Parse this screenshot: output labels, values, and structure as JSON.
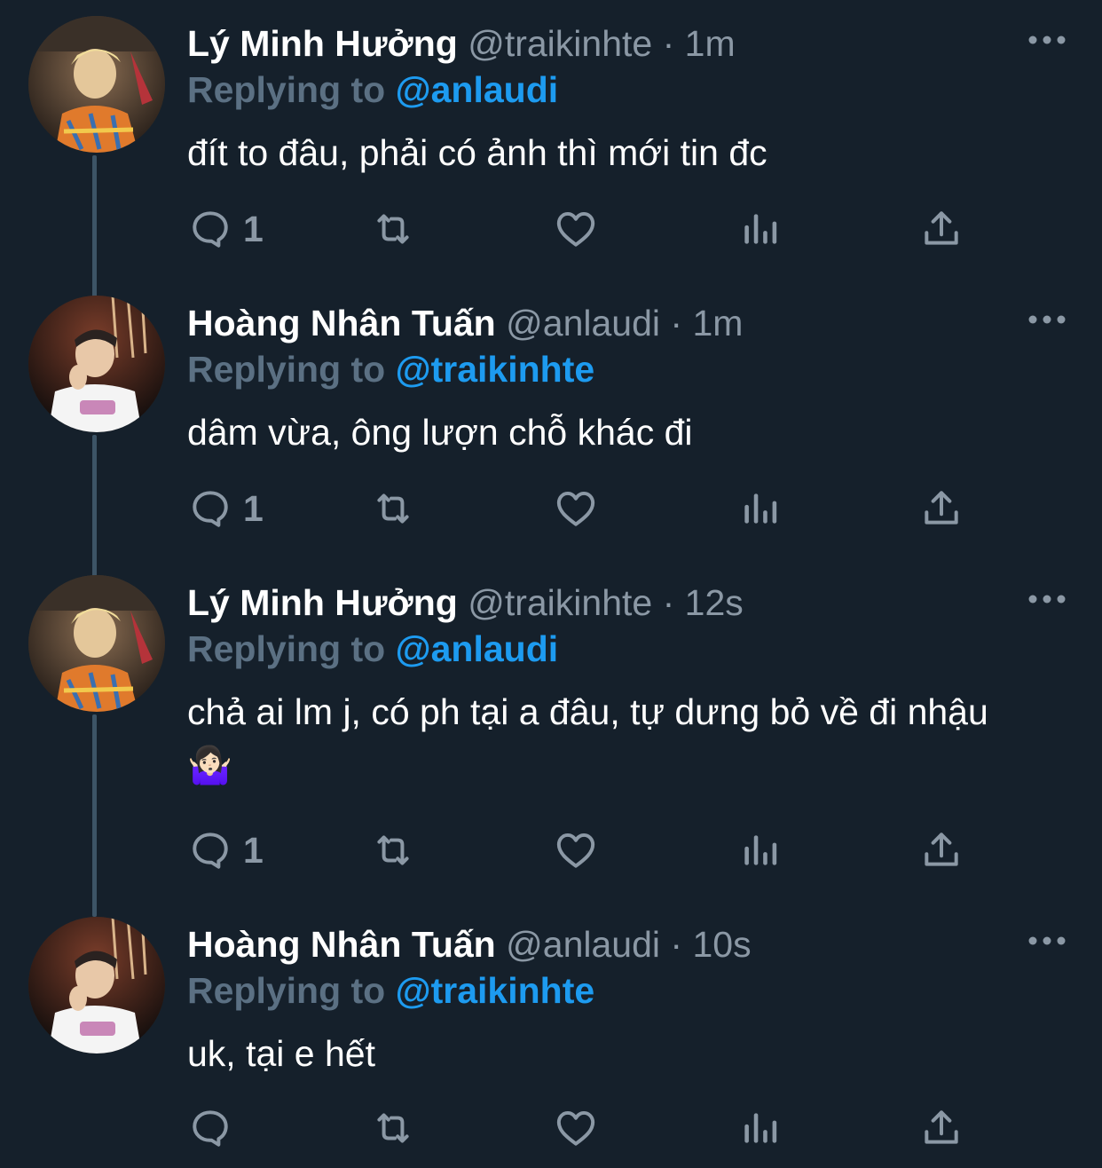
{
  "thread": {
    "tweets": [
      {
        "author_name": "Lý Minh Hưởng",
        "author_handle": "@traikinhte",
        "separator": "·",
        "time": "1m",
        "reply_label": "Replying to",
        "reply_to": "@anlaudi",
        "text": "đít to đâu, phải có ảnh thì mới tin đc",
        "reply_count": "1",
        "avatar": "photo-person-blond-checked-shirt"
      },
      {
        "author_name": "Hoàng Nhân Tuấn",
        "author_handle": "@anlaudi",
        "separator": "·",
        "time": "1m",
        "reply_label": "Replying to",
        "reply_to": "@traikinhte",
        "text": "dâm vừa, ông lượn chỗ khác đi",
        "reply_count": "1",
        "avatar": "photo-person-white-tshirt"
      },
      {
        "author_name": "Lý Minh Hưởng",
        "author_handle": "@traikinhte",
        "separator": "·",
        "time": "12s",
        "reply_label": "Replying to",
        "reply_to": "@anlaudi",
        "text": "chả ai lm j, có ph tại a đâu, tự dưng bỏ về đi nhậu🤷🏻‍♀️",
        "reply_count": "1",
        "avatar": "photo-person-blond-checked-shirt"
      },
      {
        "author_name": "Hoàng Nhân Tuấn",
        "author_handle": "@anlaudi",
        "separator": "·",
        "time": "10s",
        "reply_label": "Replying to",
        "reply_to": "@traikinhte",
        "text": "uk, tại e hết",
        "reply_count": "",
        "avatar": "photo-person-white-tshirt"
      }
    ]
  },
  "icons": {
    "reply": "reply-bubble-icon",
    "retweet": "retweet-icon",
    "like": "heart-icon",
    "analytics": "analytics-bars-icon",
    "share": "share-upload-icon",
    "more": "more-dots-icon"
  },
  "colors": {
    "background": "#15202b",
    "text": "#ffffff",
    "secondary": "#8b98a5",
    "reply_label": "#5b7083",
    "link": "#1d9bf0",
    "thread_line": "#3d5466"
  }
}
